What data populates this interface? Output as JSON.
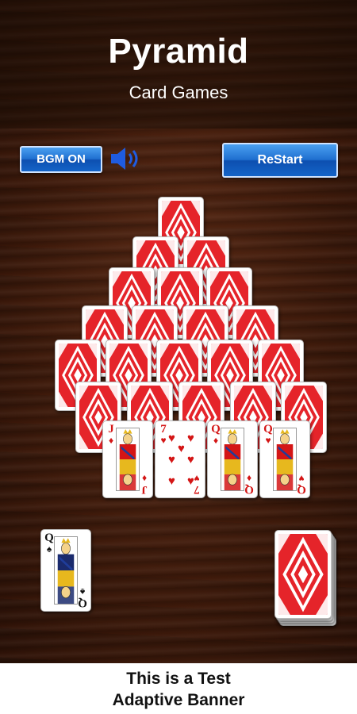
{
  "header": {
    "title": "Pyramid",
    "subtitle": "Card Games"
  },
  "controls": {
    "bgm_label": "BGM ON",
    "restart_label": "ReStart"
  },
  "pyramid_rows": [
    1,
    2,
    3,
    4,
    5,
    5
  ],
  "face_row": [
    {
      "rank": "J",
      "suit": "♦",
      "color": "red"
    },
    {
      "rank": "7",
      "suit": "♥",
      "color": "red"
    },
    {
      "rank": "Q",
      "suit": "♦",
      "color": "red"
    },
    {
      "rank": "Q",
      "suit": "♥",
      "color": "red"
    }
  ],
  "waste_card": {
    "rank": "Q",
    "suit": "♠",
    "color": "black"
  },
  "banner": {
    "line1": "This is a Test",
    "line2": "Adaptive Banner"
  },
  "colors": {
    "card_back": "#e5242a",
    "button": "#1f6fd0",
    "wood": "#3d1a0b"
  }
}
